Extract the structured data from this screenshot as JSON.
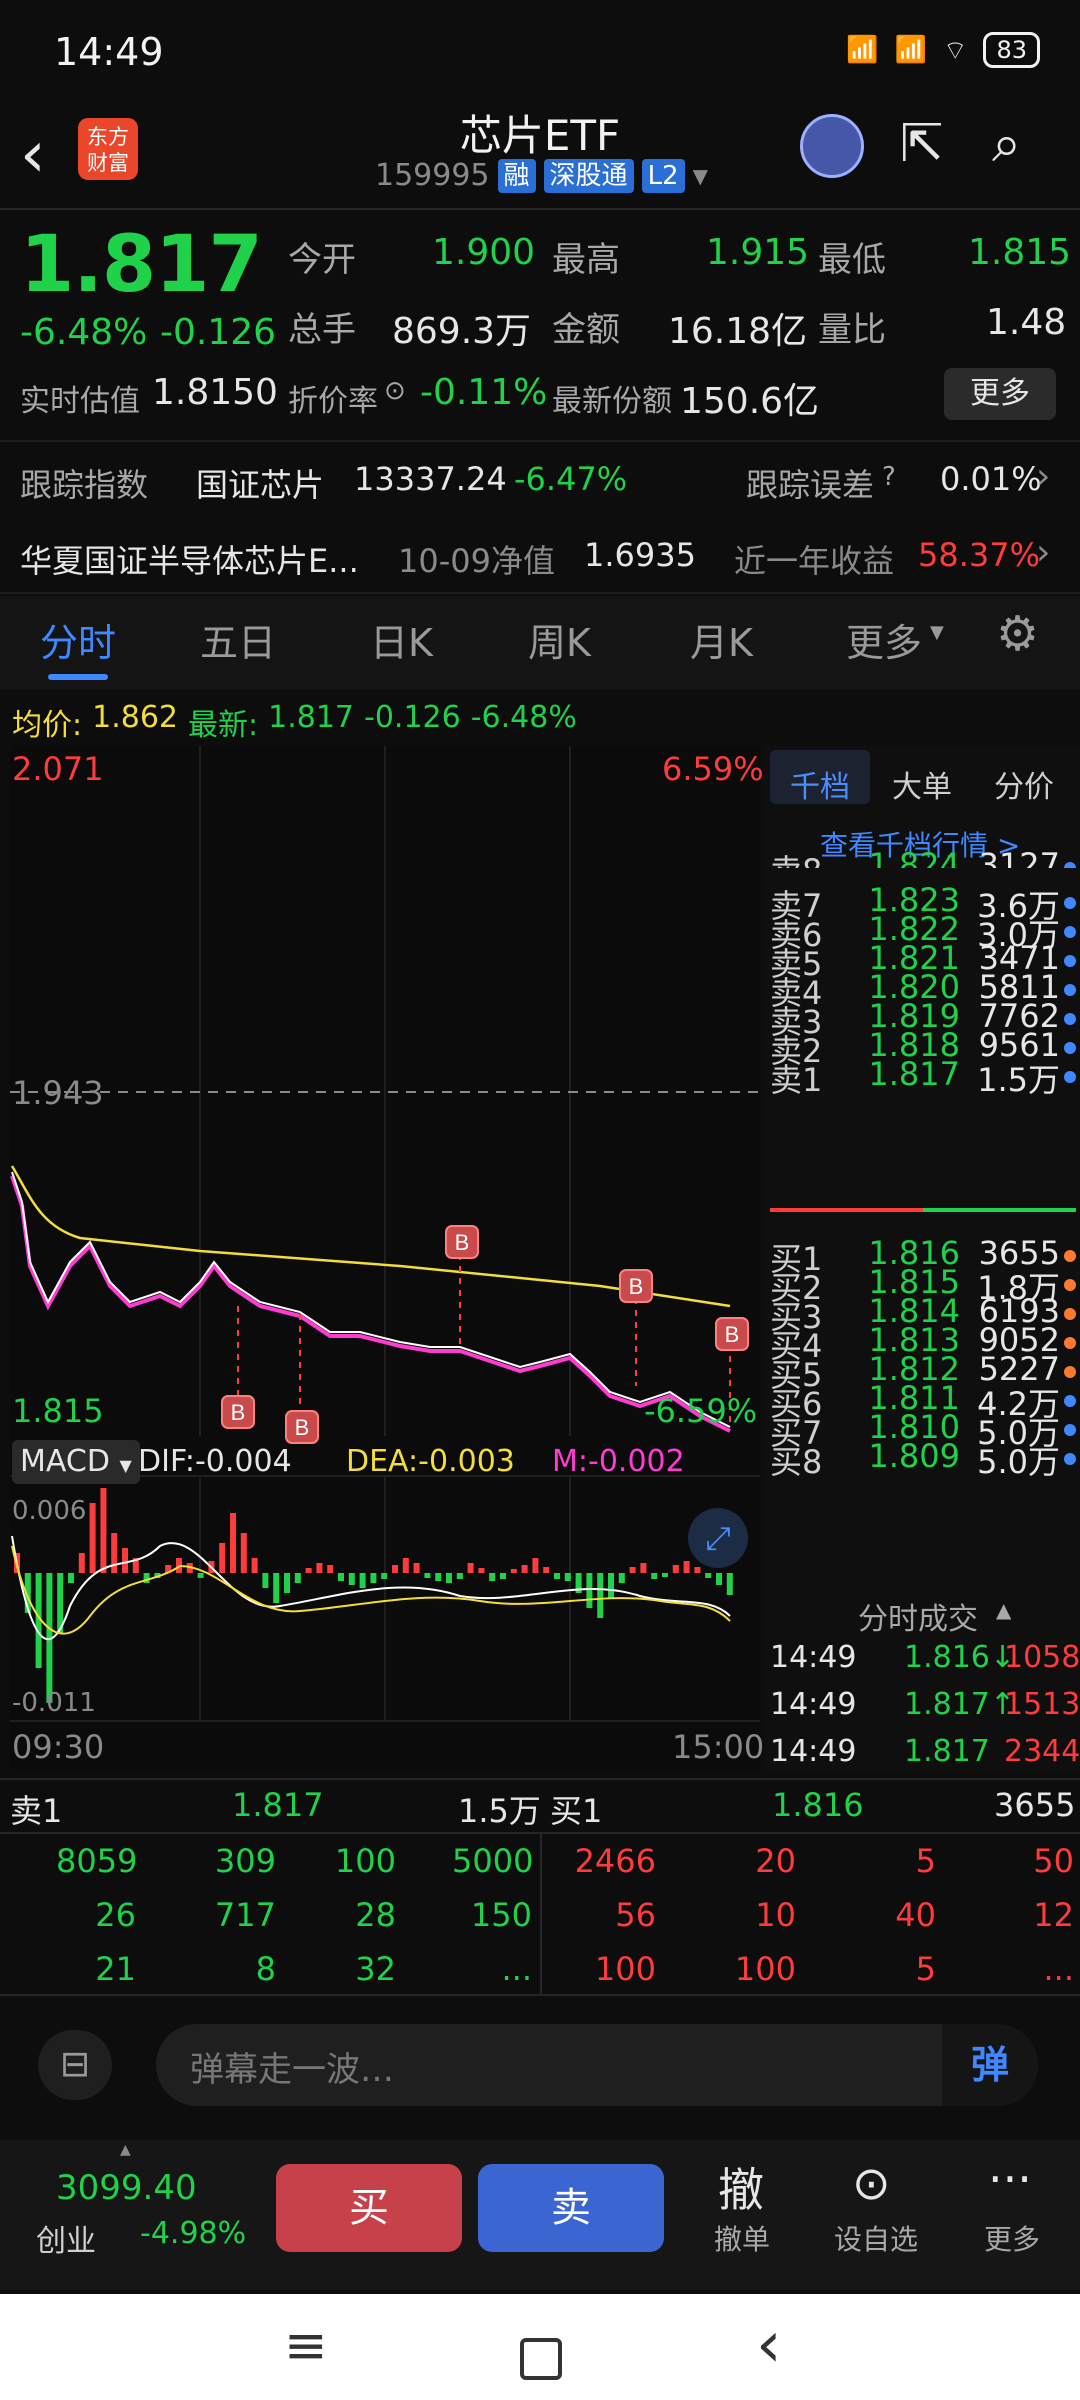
{
  "status_bar": {
    "time": "14:49",
    "battery": "83"
  },
  "header": {
    "title": "芯片ETF",
    "code": "159995",
    "tags": [
      "融",
      "深股通",
      "L2"
    ],
    "logo_line1": "东方",
    "logo_line2": "财富"
  },
  "quote": {
    "price": "1.817",
    "change_pct": "-6.48%",
    "change": "-0.126",
    "open_label": "今开",
    "open": "1.900",
    "high_label": "最高",
    "high": "1.915",
    "low_label": "最低",
    "low": "1.815",
    "volume_label": "总手",
    "volume": "869.3万",
    "amount_label": "金额",
    "amount": "16.18亿",
    "ratio_label": "量比",
    "ratio": "1.48",
    "iopv_label": "实时估值",
    "iopv": "1.8150",
    "discount_label": "折价率",
    "discount": "-0.11%",
    "shares_label": "最新份额",
    "shares": "150.6亿",
    "more_label": "更多"
  },
  "tracking": {
    "index_label": "跟踪指数",
    "index_name": "国证芯片",
    "index_value": "13337.24",
    "index_pct": "-6.47%",
    "error_label": "跟踪误差",
    "error_value": "0.01%"
  },
  "fund": {
    "name": "华夏国证半导体芯片E...",
    "nav_label": "10-09净值",
    "nav": "1.6935",
    "return_label": "近一年收益",
    "return": "58.37%"
  },
  "tabs": [
    "分时",
    "五日",
    "日K",
    "周K",
    "月K",
    "更多"
  ],
  "intraday": {
    "avg_label": "均价:",
    "avg": "1.862",
    "latest_label": "最新:",
    "latest": "1.817",
    "chg": "-0.126",
    "pct": "-6.48%",
    "y_top": "2.071",
    "y_mid": "1.943",
    "y_bot": "1.815",
    "pct_top": "6.59%",
    "pct_bot": "-6.59%",
    "macd_label": "MACD",
    "dif": "DIF:-0.004",
    "dea": "DEA:-0.003",
    "m": "M:-0.002",
    "macd_top": "0.006",
    "macd_bot": "-0.011",
    "time_start": "09:30",
    "time_end": "15:00",
    "marker": "B"
  },
  "side_tabs": [
    "千档",
    "大单",
    "分价"
  ],
  "side_link": "查看千档行情 >",
  "sell_orders": [
    {
      "label": "卖8",
      "price": "1.824",
      "vol": "3127"
    },
    {
      "label": "卖7",
      "price": "1.823",
      "vol": "3.6万"
    },
    {
      "label": "卖6",
      "price": "1.822",
      "vol": "3.0万"
    },
    {
      "label": "卖5",
      "price": "1.821",
      "vol": "3471"
    },
    {
      "label": "卖4",
      "price": "1.820",
      "vol": "5811"
    },
    {
      "label": "卖3",
      "price": "1.819",
      "vol": "7762"
    },
    {
      "label": "卖2",
      "price": "1.818",
      "vol": "9561"
    },
    {
      "label": "卖1",
      "price": "1.817",
      "vol": "1.5万"
    }
  ],
  "buy_orders": [
    {
      "label": "买1",
      "price": "1.816",
      "vol": "3655"
    },
    {
      "label": "买2",
      "price": "1.815",
      "vol": "1.8万"
    },
    {
      "label": "买3",
      "price": "1.814",
      "vol": "6193"
    },
    {
      "label": "买4",
      "price": "1.813",
      "vol": "9052"
    },
    {
      "label": "买5",
      "price": "1.812",
      "vol": "5227"
    },
    {
      "label": "买6",
      "price": "1.811",
      "vol": "4.2万"
    },
    {
      "label": "买7",
      "price": "1.810",
      "vol": "5.0万"
    },
    {
      "label": "买8",
      "price": "1.809",
      "vol": "5.0万"
    }
  ],
  "trades_title": "分时成交",
  "trades": [
    {
      "time": "14:49",
      "price": "1.816↓",
      "vol": "1058"
    },
    {
      "time": "14:49",
      "price": "1.817↑",
      "vol": "1513"
    },
    {
      "time": "14:49",
      "price": "1.817",
      "vol": "2344"
    }
  ],
  "queue": {
    "sell_label": "卖1",
    "sell_price": "1.817",
    "sell_vol": "1.5万",
    "buy_label": "买1",
    "buy_price": "1.816",
    "buy_vol": "3655",
    "sell_rows": [
      [
        "8059",
        "309",
        "100",
        "5000"
      ],
      [
        "26",
        "717",
        "28",
        "150"
      ],
      [
        "21",
        "8",
        "32",
        "..."
      ]
    ],
    "buy_rows": [
      [
        "2466",
        "20",
        "5",
        "50"
      ],
      [
        "56",
        "10",
        "40",
        "12"
      ],
      [
        "100",
        "100",
        "5",
        "..."
      ]
    ]
  },
  "chat": {
    "placeholder": "弹幕走一波…",
    "danmu_label": "弹"
  },
  "bottom": {
    "index_value": "3099.40",
    "index_name": "创业",
    "index_pct": "-4.98%",
    "buy": "买",
    "sell": "卖",
    "cancel_icon": "撤",
    "cancel": "撤单",
    "watch": "设自选",
    "more": "更多"
  },
  "colors": {
    "up": "#ff3b3b",
    "down": "#1fd24a",
    "avg": "#f4dd3a",
    "accent": "#3f88ff"
  }
}
